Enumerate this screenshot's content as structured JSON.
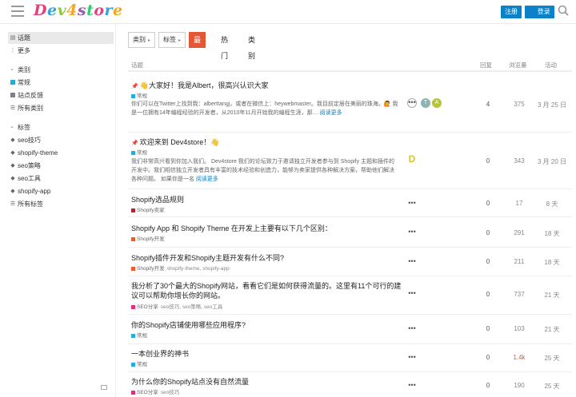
{
  "header": {
    "logo_parts": [
      "D",
      "e",
      "v",
      "4",
      "s",
      "t",
      "o",
      "r",
      "e"
    ],
    "register_label": "注册",
    "login_label": "登录"
  },
  "sidebar": {
    "top_items": [
      {
        "label": "话题",
        "icon": "topics-icon"
      },
      {
        "label": "更多",
        "icon": "more-icon"
      }
    ],
    "categories_heading": "类别",
    "categories": [
      {
        "label": "常规",
        "color": "#25aae1"
      },
      {
        "label": "站点反馈",
        "color": "#808281"
      },
      {
        "label": "所有类别",
        "color": ""
      }
    ],
    "tags_heading": "标签",
    "tags": [
      {
        "label": "seo技巧"
      },
      {
        "label": "shopify-theme"
      },
      {
        "label": "seo策略"
      },
      {
        "label": "seo工具"
      },
      {
        "label": "shopify-app"
      },
      {
        "label": "所有标签"
      }
    ]
  },
  "nav": {
    "category_dropdown": "类别",
    "tag_dropdown": "标签",
    "tabs": [
      "最新",
      "热门",
      "类别"
    ]
  },
  "table": {
    "headers": {
      "topic": "话题",
      "replies": "回复",
      "views": "浏览量",
      "activity": "活动"
    },
    "rows": [
      {
        "title": "大家好！我是Albert，很高兴认识大家",
        "category": "常规",
        "cat_color": "#25aae1",
        "tags": "",
        "excerpt": "你们可以在Twitter上找到我：alberttangj，或者在微信上：heywebmaster。我目前定居在美丽的珠海。🙋 我是一位拥有14年编程经验的开发者，从2010年11月开始我的编程生涯，那… ",
        "excerpt_more": "阅读更多",
        "replies": "4",
        "views": "375",
        "activity": "3 月 25 日"
      },
      {
        "title": "欢迎来到 Dev4store！👋",
        "category": "常规",
        "cat_color": "#25aae1",
        "tags": "",
        "excerpt": "我们非常高兴看到你加入我们。 Dev4store 我们的论坛致力于邀请独立开发者参与到 Shopify 主题和插件的开发中。我们相信独立开发者具有丰富的技术经验和创造力，能够为卖家提供各种解决方案，帮助他们解决各种问题。 如果你是一名 ",
        "excerpt_more": "阅读更多",
        "replies": "0",
        "views": "343",
        "activity": "3 月 20 日"
      },
      {
        "title": "Shopify选品规则",
        "category": "Shopify卖家",
        "cat_color": "#bf1e2e",
        "tags": "",
        "replies": "0",
        "views": "17",
        "activity": "8 天"
      },
      {
        "title": "Shopify App 和 Shopify Theme 在开发上主要有以下几个区别：",
        "category": "Shopify开发",
        "cat_color": "#f1592a",
        "tags": "",
        "replies": "0",
        "views": "291",
        "activity": "18 天"
      },
      {
        "title": "Shopify插件开发和Shopify主题开发有什么不同?",
        "category": "Shopify开发",
        "cat_color": "#f1592a",
        "tags": "shopify-theme, shopify-app",
        "replies": "0",
        "views": "211",
        "activity": "18 天"
      },
      {
        "title": "我分析了30个最大的Shopify网站，看看它们是如何获得流量的。这里有11个可行的建议可以帮助你增长你的网站。",
        "category": "SEO分享",
        "cat_color": "#e12e7c",
        "tags": "seo技巧, seo策略, seo工具",
        "replies": "0",
        "views": "737",
        "activity": "21 天"
      },
      {
        "title": "你的Shopify店铺使用哪些应用程序?",
        "category": "常规",
        "cat_color": "#25aae1",
        "tags": "",
        "replies": "0",
        "views": "103",
        "activity": "21 天"
      },
      {
        "title": "一本创业界的神书",
        "category": "常规",
        "cat_color": "#25aae1",
        "tags": "",
        "replies": "0",
        "views": "1.4k",
        "activity": "25 天"
      },
      {
        "title": "为什么你的Shopify站点没有自然流量",
        "category": "SEO分享",
        "cat_color": "#e12e7c",
        "tags": "seo技巧",
        "replies": "0",
        "views": "190",
        "activity": "25 天"
      }
    ],
    "avatars_row1": [
      "T",
      "A"
    ]
  }
}
